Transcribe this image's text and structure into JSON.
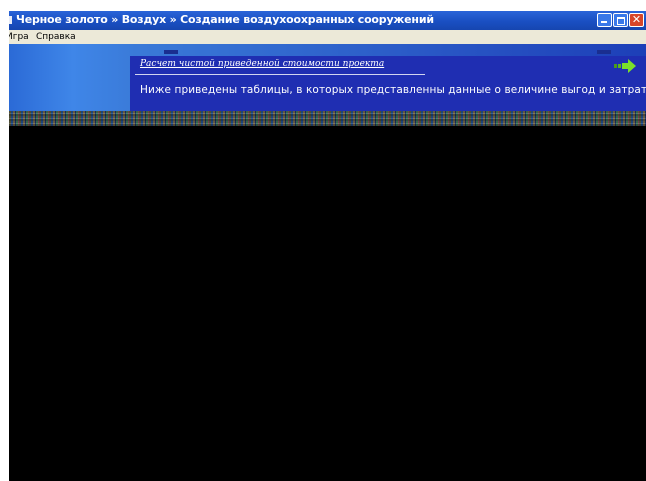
{
  "window": {
    "title": "Черное золото » Воздух » Создание воздухоохранных сооружений",
    "controls": {
      "minimize_icon": "minimize-icon",
      "maximize_icon": "maximize-icon",
      "close_label": "✕"
    }
  },
  "menu": {
    "items": [
      {
        "label": "Игра"
      },
      {
        "label": "Справка"
      }
    ]
  },
  "panel": {
    "title": "Расчет чистой приведенной стоимости проекта",
    "body": "Ниже приведены таблицы, в которых представленны данные о величине выгод и затрат",
    "next_icon": "arrow-right-icon"
  },
  "colors": {
    "titlebar": "#1a4fc2",
    "panel": "#1f2eb2",
    "next_arrow": "#7adf2a",
    "close": "#d7462a"
  }
}
